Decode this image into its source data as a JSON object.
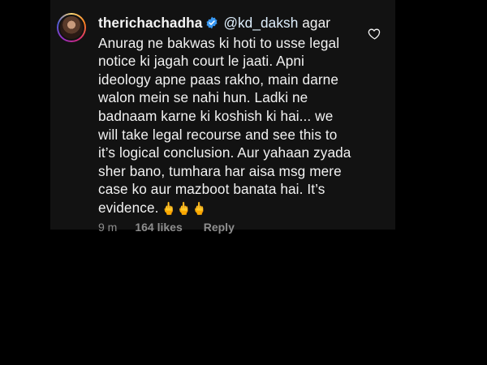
{
  "comment": {
    "username": "therichachadha",
    "verified": true,
    "mention": "@kd_daksh",
    "text": "agar Anurag ne bakwas ki hoti to usse legal notice ki jagah court le jaati. Apni ideology apne paas rakho, main darne walon mein se nahi hun. Ladki ne badnaam karne ki koshish ki hai... we will take legal recourse and see this to it’s logical conclusion. Aur yahaan zyada sher bano, tumhara har aisa msg mere case ko aur mazboot banata hai. It’s evidence.",
    "emojis": "🖕🖕🖕",
    "time": "9 m",
    "likes": "164 likes",
    "reply_label": "Reply"
  },
  "icons": {
    "avatar": "profile-avatar",
    "verified": "verified-badge-icon",
    "like": "heart-outline-icon"
  },
  "colors": {
    "background": "#000000",
    "card": "#121212",
    "verified_blue": "#3897f0",
    "meta_gray": "#8e8e8e"
  }
}
